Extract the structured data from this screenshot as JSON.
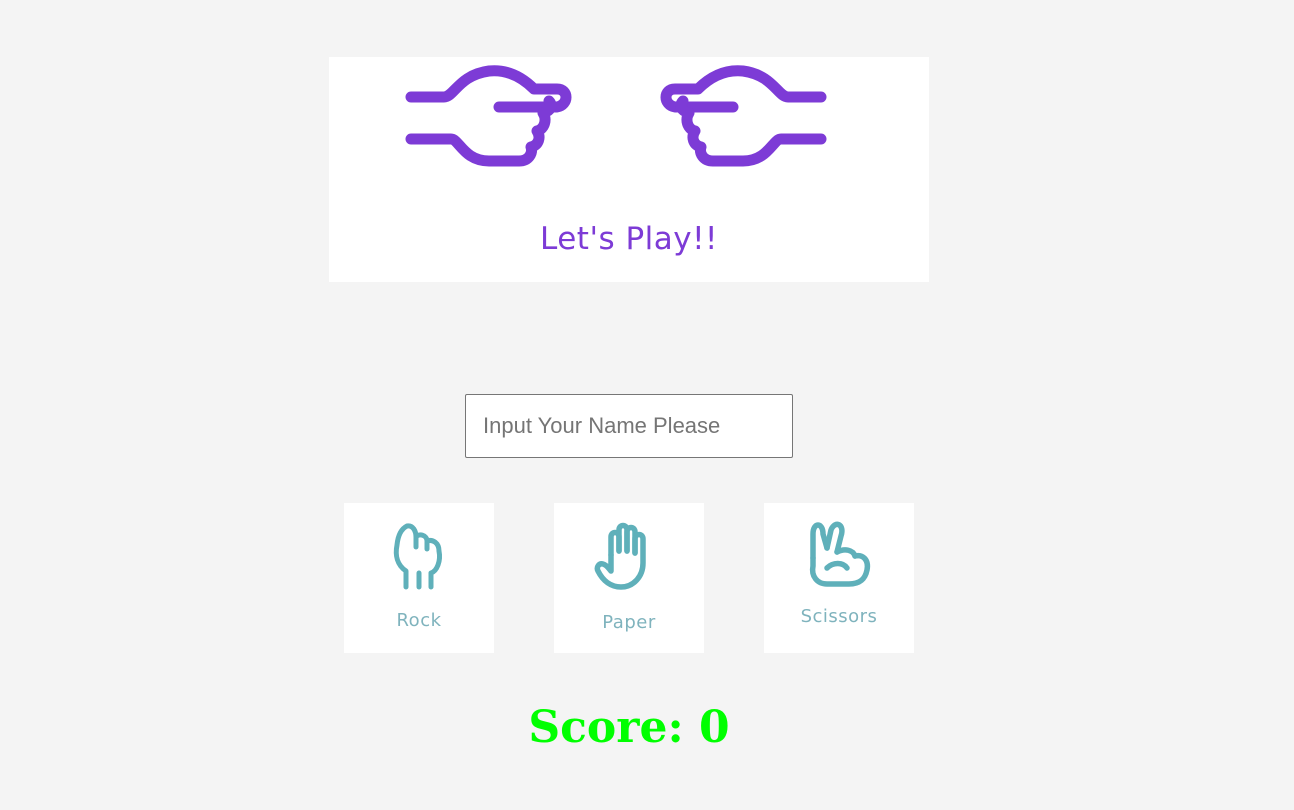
{
  "banner": {
    "title": "Let's Play!!",
    "accent_color": "#7d3bd6",
    "left_icon": "pointing-right-hand-icon",
    "right_icon": "pointing-left-hand-icon"
  },
  "name_input": {
    "placeholder": "Input Your Name Please",
    "value": ""
  },
  "choices": [
    {
      "label": "Rock",
      "icon": "fist-icon"
    },
    {
      "label": "Paper",
      "icon": "open-hand-icon"
    },
    {
      "label": "Scissors",
      "icon": "peace-hand-icon"
    }
  ],
  "choice_color": "#5fb0ba",
  "score": {
    "text": "Score: 0",
    "color": "#00ff00"
  }
}
